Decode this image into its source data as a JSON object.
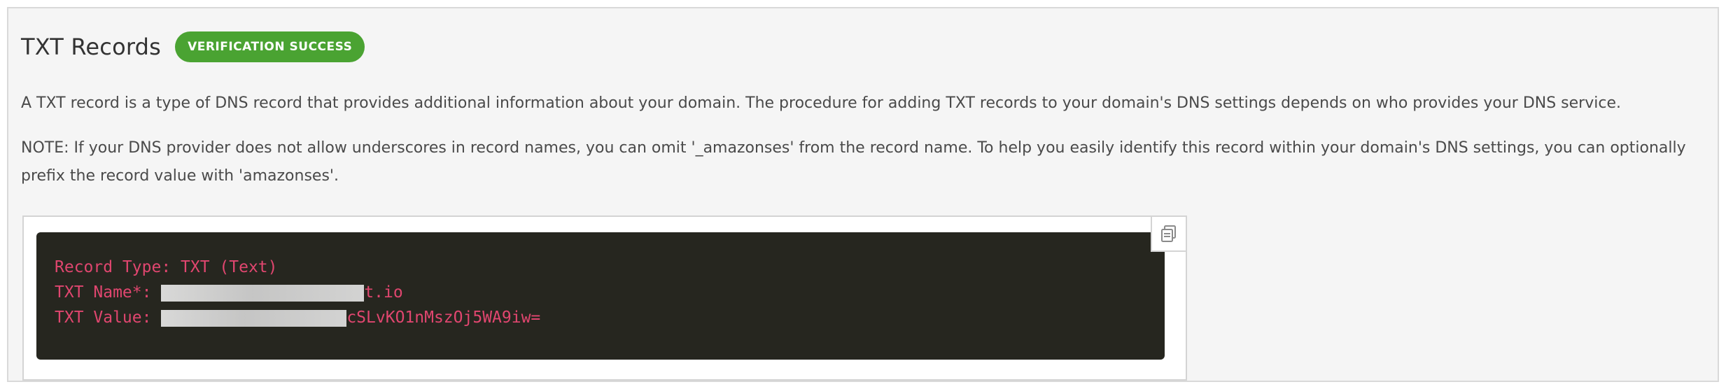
{
  "section": {
    "title": "TXT Records",
    "badge": "VERIFICATION SUCCESS",
    "badge_color": "#4aa332"
  },
  "description": {
    "p1": "A TXT record is a type of DNS record that provides additional information about your domain. The procedure for adding TXT records to your domain's DNS settings depends on who provides your DNS service.",
    "p2": "NOTE: If your DNS provider does not allow underscores in record names, you can omit '_amazonses' from the record name. To help you easily identify this record within your domain's DNS settings, you can optionally prefix the record value with 'amazonses'."
  },
  "code": {
    "line1": "Record Type: TXT (Text)",
    "name_label": "TXT Name*: ",
    "name_suffix": "t.io",
    "value_label": "TXT Value: ",
    "value_suffix": "cSLvKO1nMszOj5WA9iw=",
    "text_color": "#e0466f",
    "background": "#26261f"
  },
  "icons": {
    "copy": "copy-icon"
  }
}
